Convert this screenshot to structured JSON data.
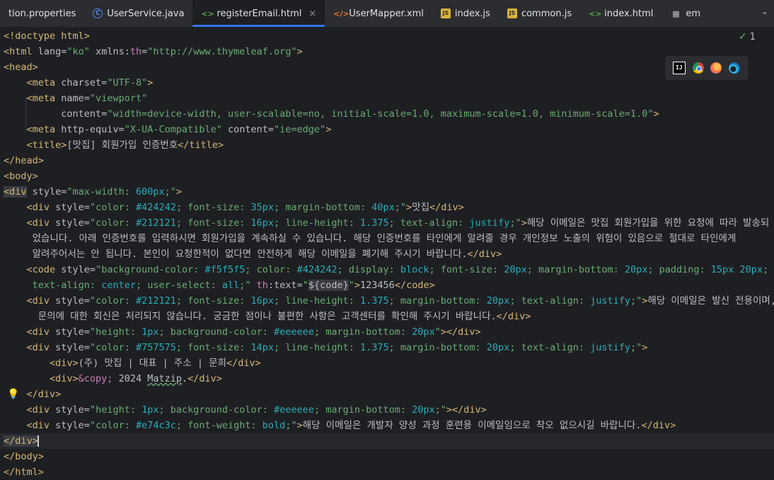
{
  "tabs": [
    {
      "label": "tion.properties",
      "icon": "properties-file-icon"
    },
    {
      "label": "UserService.java",
      "icon": "java-class-icon"
    },
    {
      "label": "registerEmail.html",
      "icon": "html-file-icon",
      "active": true
    },
    {
      "label": "UserMapper.xml",
      "icon": "xml-file-icon"
    },
    {
      "label": "index.js",
      "icon": "js-file-icon"
    },
    {
      "label": "common.js",
      "icon": "js-file-icon"
    },
    {
      "label": "index.html",
      "icon": "html-file-icon"
    },
    {
      "label": "em",
      "icon": "table-icon"
    }
  ],
  "tab_close": "×",
  "inspection_count": "1",
  "code": {
    "l1": "<!doctype html>",
    "l2_open": "<html",
    "l2_attr1": " lang=",
    "l2_val1": "\"ko\"",
    "l2_attr2": " xmlns:",
    "l2_ns": "th",
    "l2_eq": "=",
    "l2_val2": "\"http://www.thymeleaf.org\"",
    "l2_close": ">",
    "l3": "<head>",
    "l4_tag": "<meta",
    "l4_attr": " charset=",
    "l4_val": "\"UTF-8\"",
    "l4_close": ">",
    "l5_tag": "<meta",
    "l5_attr": " name=",
    "l5_val": "\"viewport\"",
    "l6_attr": "content=",
    "l6_val": "\"width=device-width, user-scalable=no, initial-scale=1.0, maximum-scale=1.0, minimum-scale=1.0\"",
    "l6_close": ">",
    "l7_tag": "<meta",
    "l7_attr1": " http-equiv=",
    "l7_val1": "\"X-UA-Compatible\"",
    "l7_attr2": " content=",
    "l7_val2": "\"ie=edge\"",
    "l7_close": ">",
    "l8_open": "<title>",
    "l8_text": "[맛집] 회원가입 인증번호",
    "l8_close": "</title>",
    "l9": "</head>",
    "l10": "<body>",
    "l11_open": "<div",
    "l11_attr": " style=",
    "l11_v1": "\"max-width: ",
    "l11_n1": "600px",
    "l11_v2": ";\"",
    "l11_close": ">",
    "l12_tag": "<div",
    "l12_attr": " style=",
    "l12_v1": "\"color: ",
    "l12_n1": "#424242",
    "l12_v2": "; font-size: ",
    "l12_n2": "35px",
    "l12_v3": "; margin-bottom: ",
    "l12_n3": "40px",
    "l12_v4": ";\"",
    "l12_gt": ">",
    "l12_text": "맛집",
    "l12_close": "</div>",
    "l13_tag": "<div",
    "l13_attr": " style=",
    "l13_v1": "\"color: ",
    "l13_n1": "#212121",
    "l13_v2": "; font-size: ",
    "l13_n2": "16px",
    "l13_v3": "; line-height: ",
    "l13_n3": "1.375",
    "l13_v4": "; text-align: ",
    "l13_n4": "justify",
    "l13_v5": ";\"",
    "l13_gt": ">",
    "l13_text": "해당 이메일은 맛집 회원가입을 위한 요청에 따라 발송되",
    "l14_text": "었습니다. 아래 인증번호를 입력하시면 회원가입을 계속하실 수 있습니다. 해당 인증번호를 타인에게 알려줄 경우 개인정보 노출의 위험이 있음으로 절대로 타인에게",
    "l15_text": "알려주어서는 안 됩니다. 본인이 요청한적이 없다면 안전하게 해당 이메일을 폐기해 주시기 바랍니다.",
    "l15_close": "</div>",
    "l16_tag": "<code",
    "l16_attr": " style=",
    "l16_v1": "\"background-color: ",
    "l16_n1": "#f5f5f5",
    "l16_v2": "; color: ",
    "l16_n2": "#424242",
    "l16_v3": "; display: ",
    "l16_n3": "block",
    "l16_v4": "; font-size: ",
    "l16_n4": "20px",
    "l16_v5": "; margin-bottom: ",
    "l16_n5": "20px",
    "l16_v6": "; padding: ",
    "l16_n6": "15px 20px",
    "l16_v7": ";",
    "l17_v1": "text-align: ",
    "l17_n1": "center",
    "l17_v2": "; user-select: ",
    "l17_n2": "all",
    "l17_v3": ";\"",
    "l17_ns": " th",
    "l17_attr": ":text=",
    "l17_q1": "\"",
    "l17_expr": "${code}",
    "l17_q2": "\"",
    "l17_gt": ">",
    "l17_text": "123456",
    "l17_close": "</code>",
    "l18_tag": "<div",
    "l18_attr": " style=",
    "l18_v1": "\"color: ",
    "l18_n1": "#212121",
    "l18_v2": "; font-size: ",
    "l18_n2": "16px",
    "l18_v3": "; line-height: ",
    "l18_n3": "1.375",
    "l18_v4": "; margin-bottom: ",
    "l18_n4": "20px",
    "l18_v5": "; text-align: ",
    "l18_n5": "justify",
    "l18_v6": ";\"",
    "l18_gt": ">",
    "l18_text": "해당 이메일은 발신 전용이며,",
    "l19_text": "문의에 대한 회신은 처리되지 않습니다. 궁금한 점이나 불편한 사항은 고객센터를 확인해 주시기 바랍니다.",
    "l19_close": "</div>",
    "l20_tag": "<div",
    "l20_attr": " style=",
    "l20_v1": "\"height: ",
    "l20_n1": "1px",
    "l20_v2": "; background-color: ",
    "l20_n2": "#eeeeee",
    "l20_v3": "; margin-bottom: ",
    "l20_n3": "20px",
    "l20_v4": "\"",
    "l20_close": "></div>",
    "l21_tag": "<div",
    "l21_attr": " style=",
    "l21_v1": "\"color: ",
    "l21_n1": "#757575",
    "l21_v2": "; font-size: ",
    "l21_n2": "14px",
    "l21_v3": "; line-height: ",
    "l21_n3": "1.375",
    "l21_v4": "; margin-bottom: ",
    "l21_n4": "20px",
    "l21_v5": "; text-align: ",
    "l21_n5": "justify",
    "l21_v6": ";\"",
    "l21_gt": ">",
    "l22_open": "<div>",
    "l22_text": "(주) 맛집 | 대표 | 주소 | 문희",
    "l22_close": "</div>",
    "l23_open": "<div>",
    "l23_ent": "&copy;",
    "l23_text": " 2024 ",
    "l23_word": "Matzip",
    "l23_dot": ".",
    "l23_close": "</div>",
    "l24": "</div>",
    "l25_tag": "<div",
    "l25_attr": " style=",
    "l25_v1": "\"height: ",
    "l25_n1": "1px",
    "l25_v2": "; background-color: ",
    "l25_n2": "#eeeeee",
    "l25_v3": "; margin-bottom: ",
    "l25_n3": "20px",
    "l25_v4": ";\"",
    "l25_close": "></div>",
    "l26_tag": "<div",
    "l26_attr": " style=",
    "l26_v1": "\"color: ",
    "l26_n1": "#e74c3c",
    "l26_v2": "; font-weight: ",
    "l26_n2": "bold",
    "l26_v3": ";\"",
    "l26_gt": ">",
    "l26_text": "해당 이메일은 개발자 양성 과정 훈련용 이메일임으로 착오 없으시길 바랍니다.",
    "l26_close": "</div>",
    "l27": "</div>",
    "l28": "</body>",
    "l29": "</html>"
  },
  "colors": {
    "accent": "#3574f0",
    "tag": "#d5b778",
    "string": "#6aab73",
    "number": "#2aacb8",
    "keyword": "#c77dbb"
  }
}
